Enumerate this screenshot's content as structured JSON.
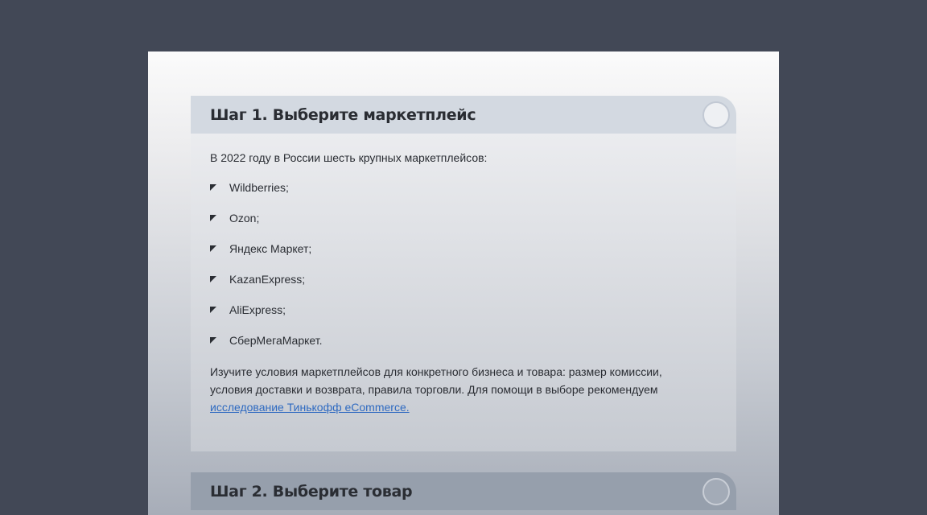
{
  "steps": [
    {
      "title": "Шаг 1. Выберите маркетплейс",
      "intro": "В 2022 году в России шесть крупных маркетплейсов:",
      "items": [
        "Wildberries;",
        "Ozon;",
        "Яндекс Маркет;",
        "KazanExpress;",
        "AliExpress;",
        "СберМегаМаркет."
      ],
      "outro_text": "Изучите условия маркетплейсов для конкретного бизнеса и товара: размер комиссии, условия доставки и возврата, правила торговли. Для помощи в выборе рекомендуем ",
      "outro_link": "исследование Тинькофф eCommerce."
    },
    {
      "title": "Шаг 2. Выберите товар"
    }
  ],
  "colors": {
    "background": "#424856",
    "link": "#2f6ac1"
  },
  "icons": {
    "toggle": "circle-toggle-icon",
    "bullet": "corner-triangle-icon"
  }
}
